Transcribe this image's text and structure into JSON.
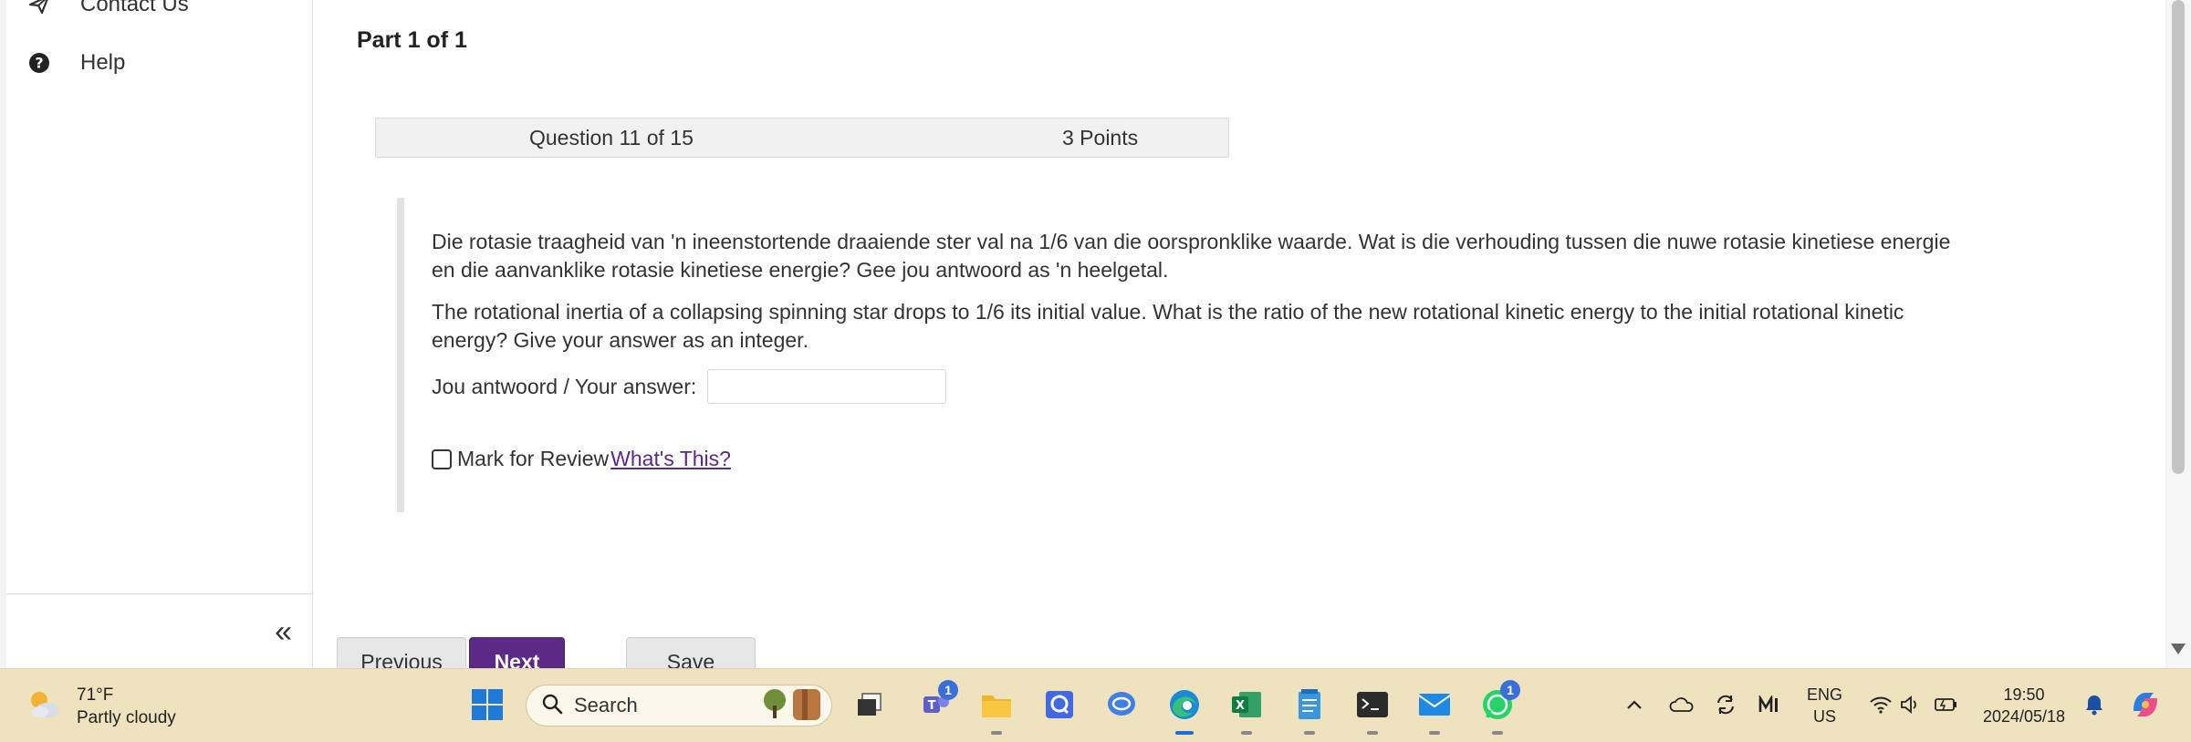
{
  "sidebar": {
    "items": [
      {
        "label": "Contact Us",
        "icon": "paper-plane-icon"
      },
      {
        "label": "Help",
        "icon": "question-circle-icon"
      }
    ],
    "collapse_icon": "double-chevron-left-icon",
    "collapse_glyph": "«"
  },
  "main": {
    "part_title": "Part 1 of 1",
    "question_number": "Question 11 of 15",
    "points": "3 Points",
    "question_afrikaans": "Die rotasie traagheid van 'n ineenstortende draaiende ster val na 1/6 van die oorspronklike waarde. Wat is die verhouding tussen die nuwe rotasie kinetiese energie en die aanvanklike rotasie kinetiese energie? Gee jou antwoord as 'n heelgetal.",
    "question_english": "The rotational inertia of a collapsing spinning star drops to 1/6 its initial value. What is the ratio of the new rotational kinetic energy to the initial rotational kinetic energy? Give your answer as an integer.",
    "answer_label": "Jou antwoord / Your answer:",
    "answer_value": "",
    "mark_review_label": "Mark for Review",
    "whats_this_label": " What's This?",
    "buttons": {
      "previous": "Previous",
      "next": "Next",
      "save": "Save"
    }
  },
  "colors": {
    "accent": "#5b2a86",
    "taskbar": "#efe3bf"
  },
  "taskbar": {
    "weather_temp": "71°F",
    "weather_desc": "Partly cloudy",
    "search_label": "Search",
    "teams_badge": "1",
    "whatsapp_badge": "1",
    "language_line1": "ENG",
    "language_line2": "US",
    "time": "19:50",
    "date": "2024/05/18"
  }
}
